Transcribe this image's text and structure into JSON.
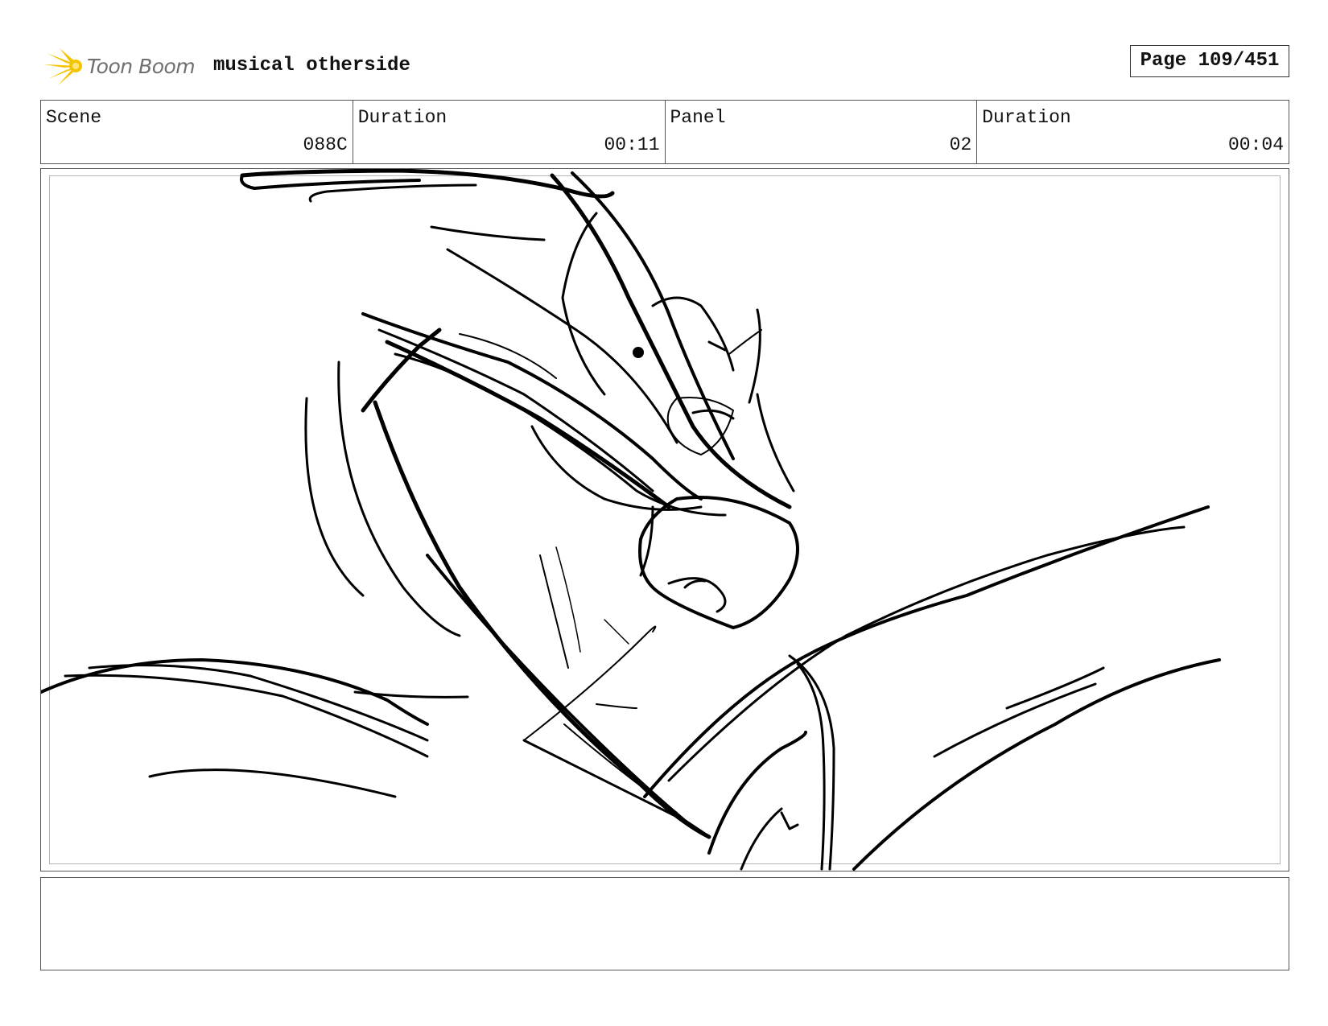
{
  "header": {
    "logo_text": "Toon Boom",
    "project_title": "musical otherside",
    "page_label": "Page 109/451"
  },
  "info": {
    "scene_label": "Scene",
    "scene_value": "088C",
    "scene_duration_label": "Duration",
    "scene_duration_value": "00:11",
    "panel_label": "Panel",
    "panel_value": "02",
    "panel_duration_label": "Duration",
    "panel_duration_value": "00:04"
  },
  "notes": {
    "text": ""
  },
  "colors": {
    "logo_flare": "#f5c400",
    "logo_text": "#6f6f6f",
    "ink": "#000000",
    "border": "#555555"
  }
}
